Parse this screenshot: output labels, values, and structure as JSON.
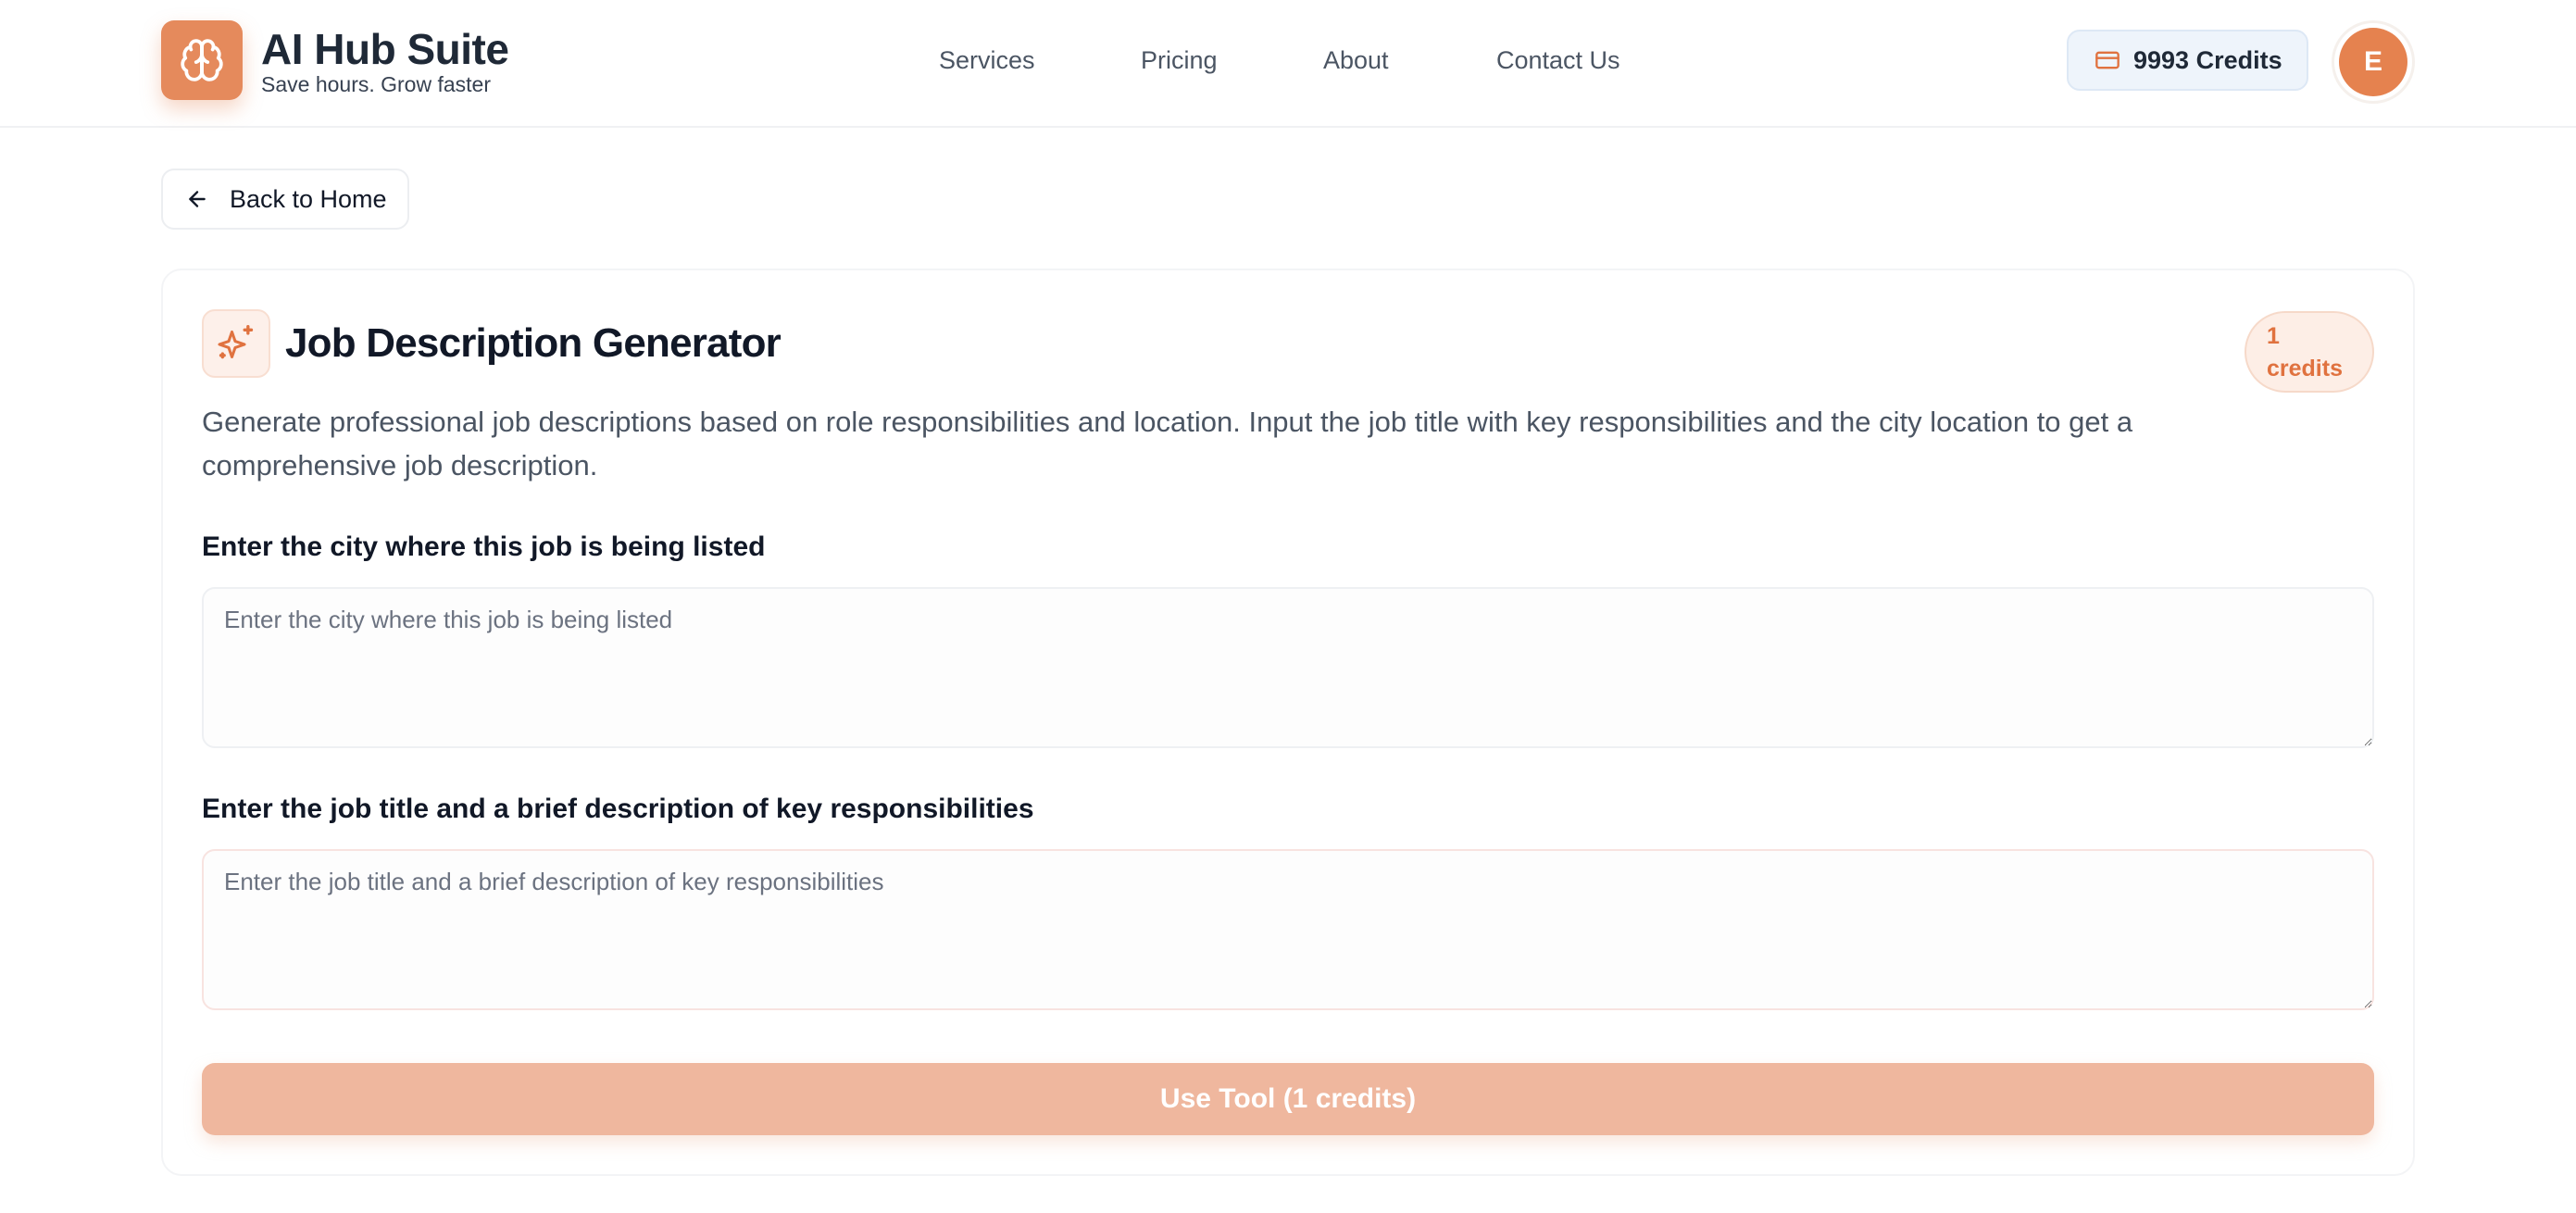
{
  "header": {
    "brand_title": "AI Hub Suite",
    "brand_tagline": "Save hours. Grow faster",
    "nav": [
      {
        "label": "Services"
      },
      {
        "label": "Pricing"
      },
      {
        "label": "About"
      },
      {
        "label": "Contact Us"
      }
    ],
    "credits_label": "9993 Credits",
    "avatar_initial": "E"
  },
  "back_button": {
    "label": "Back to Home"
  },
  "tool": {
    "title": "Job Description Generator",
    "cost_badge_number": "1",
    "cost_badge_unit": "credits",
    "description": "Generate professional job descriptions based on role responsibilities and location. Input the job title with key responsibilities and the city location to get a comprehensive job description.",
    "fields": [
      {
        "label": "Enter the city where this job is being listed",
        "placeholder": "Enter the city where this job is being listed",
        "value": ""
      },
      {
        "label": "Enter the job title and a brief description of key responsibilities",
        "placeholder": "Enter the job title and a brief description of key responsibilities",
        "value": ""
      }
    ],
    "submit_label": "Use Tool (1 credits)"
  },
  "icons": {
    "logo": "brain-icon",
    "credits": "credit-card-icon",
    "back": "arrow-left-icon",
    "tool": "sparkles-icon"
  },
  "colors": {
    "accent": "#e58a5c",
    "accent_light": "#fdeee6",
    "submit_disabled": "#efb79e",
    "credits_bg": "#eef4fb"
  }
}
